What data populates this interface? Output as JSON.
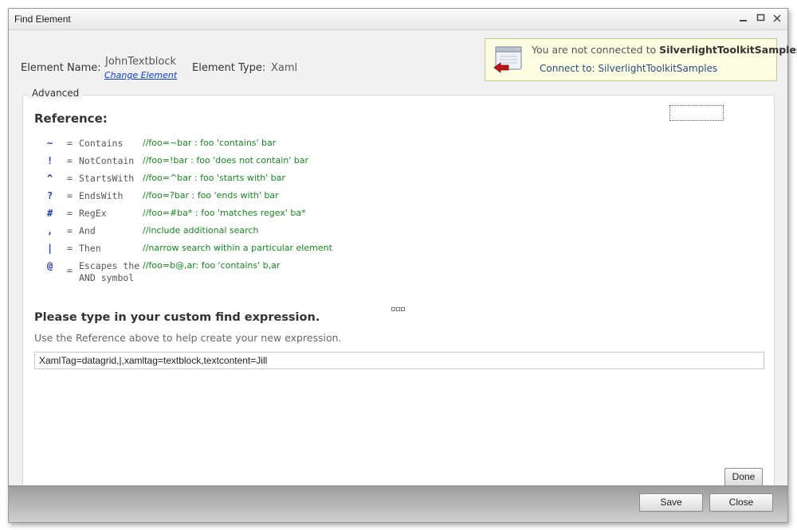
{
  "window": {
    "title": "Find Element"
  },
  "header": {
    "element_name_label": "Element Name:",
    "element_name_value": "JohnTextblock",
    "change_element_link": "Change Element",
    "element_type_label": "Element Type:",
    "element_type_value": "Xaml"
  },
  "connection": {
    "message_prefix": "You are not connected to ",
    "message_target": "SilverlightToolkitSamples",
    "connect_link": "Connect to: SilverlightToolkitSamples"
  },
  "advanced": {
    "group_label": "Advanced",
    "reference_title": "Reference:",
    "operators": [
      {
        "symbol": "~",
        "name": "Contains",
        "comment": "//foo=~bar : foo 'contains' bar"
      },
      {
        "symbol": "!",
        "name": "NotContain",
        "comment": "//foo=!bar : foo 'does not contain' bar"
      },
      {
        "symbol": "^",
        "name": "StartsWith",
        "comment": "//foo=^bar : foo 'starts with' bar"
      },
      {
        "symbol": "?",
        "name": "EndsWith",
        "comment": "//foo=?bar : foo 'ends with' bar"
      },
      {
        "symbol": "#",
        "name": "RegEx",
        "comment": "//foo=#ba* : foo 'matches regex' ba*"
      },
      {
        "symbol": ",",
        "name": "And",
        "comment": "//include additional search"
      },
      {
        "symbol": "|",
        "name": "Then",
        "comment": "//narrow search within a particular element"
      },
      {
        "symbol": "@",
        "name": "Escapes the AND symbol",
        "comment": "//foo=b@,ar: foo 'contains' b,ar"
      }
    ],
    "prompt_title": "Please type in your custom find expression.",
    "prompt_hint": "Use the Reference above to help create your new expression.",
    "expression_value": "XamlTag=datagrid,|,xamltag=textblock,textcontent=Jill",
    "done_label": "Done"
  },
  "footer": {
    "save_label": "Save",
    "close_label": "Close"
  },
  "colors": {
    "comment": "#118a1a",
    "symbol": "#1f3faa",
    "link": "#0a3cd6",
    "banner_bg": "#fdfde2"
  }
}
